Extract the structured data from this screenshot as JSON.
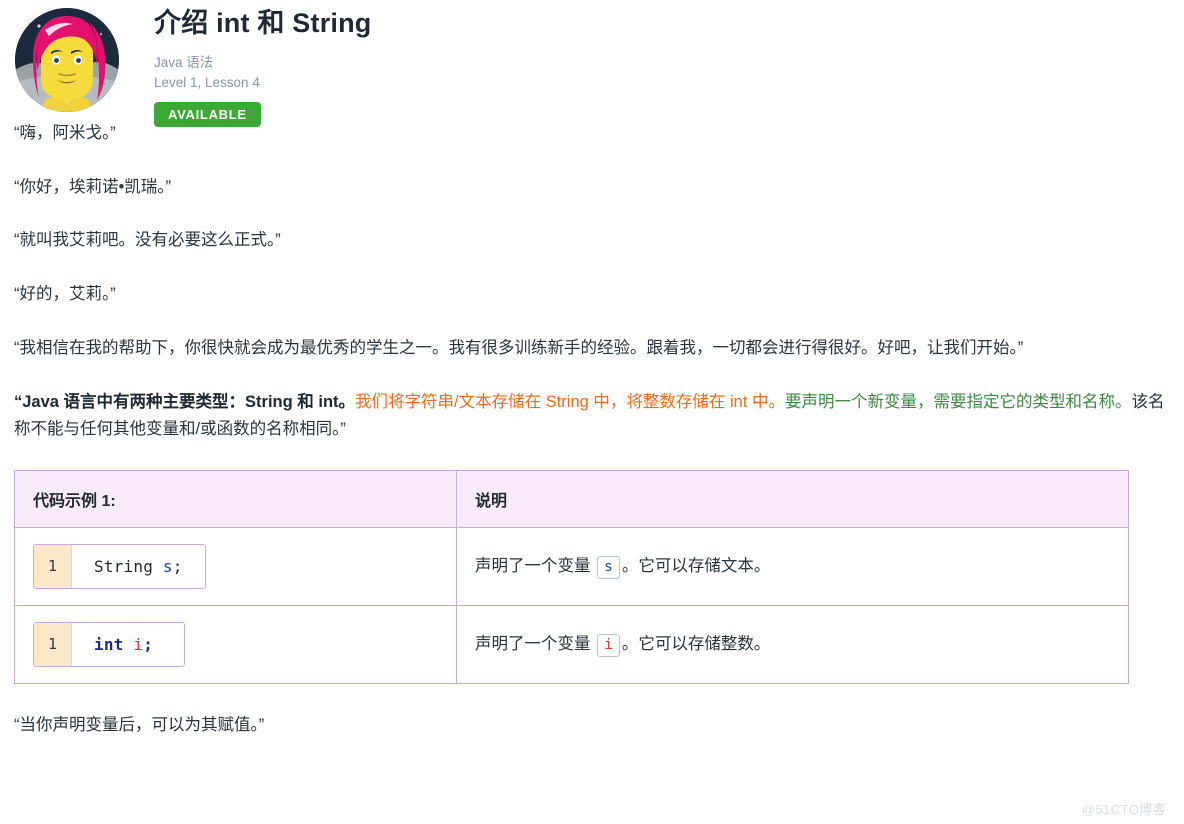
{
  "header": {
    "title": "介绍 int 和 String",
    "course": "Java 语法",
    "level_lesson": "Level 1, Lesson 4",
    "status_badge": "AVAILABLE",
    "badge_color": "#3ba935",
    "avatar_name": "ellie-avatar"
  },
  "dialogue": [
    {
      "speaker": "amigo-narrator",
      "color": "#2b333b",
      "text": "“嗨，阿米戈。”"
    },
    {
      "speaker": "amigo",
      "color": "#1b49c4",
      "text": "“你好，埃莉诺•凯瑞。”"
    },
    {
      "speaker": "ellie",
      "color": "#2b333b",
      "text": "“就叫我艾莉吧。没有必要这么正式。”"
    },
    {
      "speaker": "amigo",
      "color": "#1b49c4",
      "text": "“好的，艾莉。”"
    },
    {
      "speaker": "ellie",
      "color": "#2b333b",
      "text": "“我相信在我的帮助下，你很快就会成为最优秀的学生之一。我有很多训练新手的经验。跟着我，一切都会进行得很好。好吧，让我们开始。”"
    }
  ],
  "types_paragraph": {
    "part_bold": "“Java 语言中有两种主要类型：String 和 int。",
    "part_orange": "我们将字符串/文本存储在 String 中，将整数存储在 int 中。",
    "part_green": "要声明一个新变量，需要指定它的类型和名称。",
    "part_plain": "该名称不能与任何其他变量和/或函数的名称相同。”",
    "orange_color": "#ed6b1f",
    "green_color": "#3d8a3f"
  },
  "table": {
    "headers": [
      "代码示例 1:",
      "说明"
    ],
    "border_color": "#cda9dc",
    "header_bg": "#f8eaf9",
    "rows": [
      {
        "line_number": "1",
        "code_tokens": [
          {
            "text": "String",
            "color": "#24292e",
            "bold": false
          },
          {
            "text": " ",
            "color": "#24292e",
            "bold": false
          },
          {
            "text": "s",
            "color": "#1b49c4",
            "bold": false
          },
          {
            "text": ";",
            "color": "#24292e",
            "bold": false
          }
        ],
        "code_plain": "String s;",
        "desc_before": "声明了一个变量",
        "desc_chip": "s",
        "desc_chip_color": "#1b49c4",
        "desc_after": "。它可以存储文本。"
      },
      {
        "line_number": "1",
        "code_tokens": [
          {
            "text": "int",
            "color": "#1c2b8c",
            "bold": true
          },
          {
            "text": " ",
            "color": "#24292e",
            "bold": false
          },
          {
            "text": "i",
            "color": "#e03030",
            "bold": true
          },
          {
            "text": ";",
            "color": "#1c2b8c",
            "bold": true
          }
        ],
        "code_plain": "int i;",
        "desc_before": "声明了一个变量",
        "desc_chip": "i",
        "desc_chip_color": "#e03030",
        "desc_after": "。它可以存储整数。"
      }
    ]
  },
  "closing_paragraph": "“当你声明变量后，可以为其赋值。”",
  "watermark": "@51CTO博客"
}
